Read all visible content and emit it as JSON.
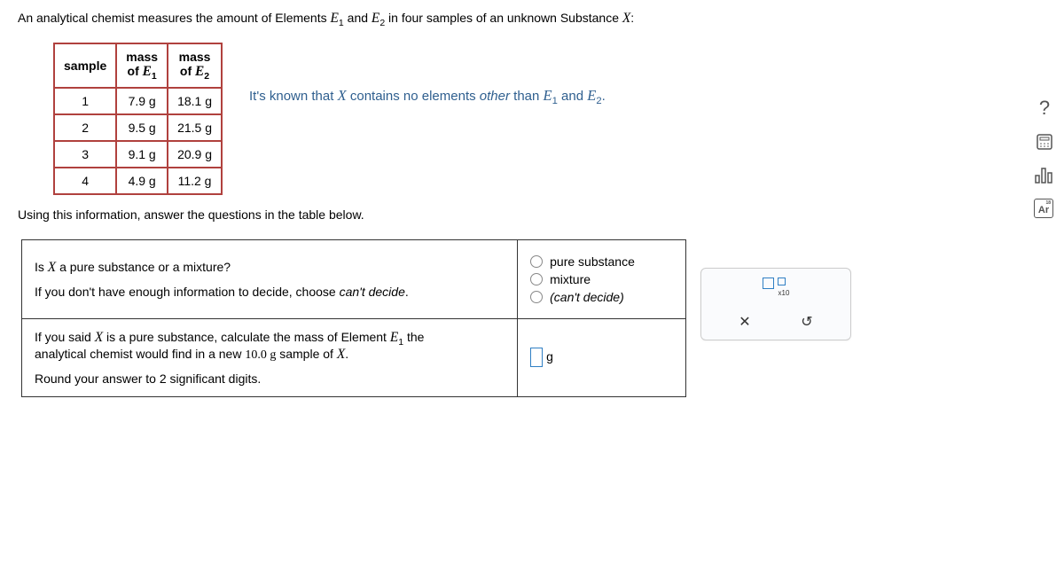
{
  "intro_prefix": "An analytical chemist measures the amount of Elements ",
  "e1": "E",
  "e1_sub": "1",
  "intro_and": " and ",
  "e2": "E",
  "e2_sub": "2",
  "intro_suffix": " in four samples of an unknown Substance ",
  "x": "X",
  "intro_colon": ":",
  "table": {
    "h_sample": "sample",
    "h_mass_pre": "mass",
    "h_of": "of ",
    "rows": [
      {
        "s": "1",
        "m1": "7.9 g",
        "m2": "18.1 g"
      },
      {
        "s": "2",
        "m1": "9.5 g",
        "m2": "21.5 g"
      },
      {
        "s": "3",
        "m1": "9.1 g",
        "m2": "20.9 g"
      },
      {
        "s": "4",
        "m1": "4.9 g",
        "m2": "11.2 g"
      }
    ]
  },
  "note_pre": "It's known that ",
  "note_mid1": " contains no elements ",
  "note_other": "other",
  "note_mid2": " than ",
  "note_and": " and ",
  "note_dot": ".",
  "using_line": "Using this information, answer the questions in the table below.",
  "q1": {
    "line1_pre": "Is ",
    "line1_post": " a pure substance or a mixture?",
    "line2_pre": "If you don't have enough information to decide, choose ",
    "line2_ital": "can't decide",
    "line2_dot": ".",
    "opt1": "pure substance",
    "opt2": "mixture",
    "opt3": "(can't decide)"
  },
  "q2": {
    "line1_pre": "If you said ",
    "line1_mid": " is a pure substance, calculate the mass of Element ",
    "line1_post": " the",
    "line2_pre": "analytical chemist would find in a new ",
    "line2_mass": "10.0 g",
    "line2_post": " sample of ",
    "line2_dot": ".",
    "line3": "Round your answer to 2 significant digits.",
    "unit": "g"
  },
  "helper": {
    "x10": "x10",
    "x_btn": "✕",
    "reset_btn": "↺"
  },
  "rail": {
    "help": "?",
    "ar": "Ar",
    "ar_num": "18"
  }
}
